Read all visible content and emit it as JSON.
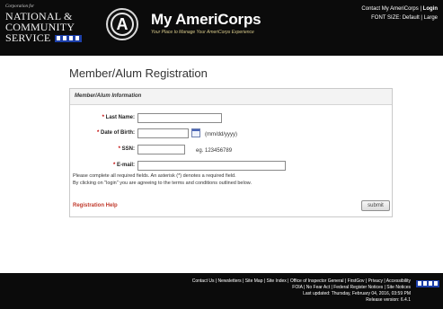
{
  "header": {
    "org_small": "Corporation for",
    "org_line1": "NATIONAL &",
    "org_line2": "COMMUNITY",
    "org_line3": "SERVICE",
    "app_title": "My AmeriCorps",
    "tagline": "Your Place to Manage Your AmeriCorps Experience",
    "contact_link": "Contact My AmeriCorps",
    "login_link": "Login",
    "font_size_label": "FONT SIZE:",
    "font_default": "Default",
    "font_large": "Large"
  },
  "main": {
    "page_title": "Member/Alum Registration",
    "section_title": "Member/Alum Information",
    "fields": {
      "last_name_label": "Last Name:",
      "dob_label": "Date of Birth:",
      "dob_hint": "(mm/dd/yyyy)",
      "ssn_label": "SSN:",
      "ssn_hint": "eg. 123456789",
      "email_label": "E-mail:",
      "required_mark": "*"
    },
    "note_line1": "Please complete all required fields. An asterisk (*) denotes a required field.",
    "note_line2": "By clicking on \"login\" you are agreeing to the terms and conditions outlined below.",
    "registration_help": "Registration Help",
    "submit_label": "submit"
  },
  "footer": {
    "links_line1": "Contact Us | Newsletters | Site Map | Site Index | Office of Inspector General | FirstGov | Privacy | Accessibility",
    "links_line2": "FOIA | No Fear Act | Federal Register Notices | Site Notices",
    "last_updated": "Last updated: Thursday, February 04, 2016, 03:59 PM",
    "release_version": "Release version: 6.4.1"
  },
  "colors": {
    "header_bg": "#0b0b0b",
    "required_red": "#c00000",
    "help_link_red": "#c0392b",
    "flag_blue": "#1d3fa8"
  },
  "icons": {
    "seal": "americorps-seal-icon",
    "calendar": "calendar-icon",
    "flag": "flag-stars-icon"
  }
}
